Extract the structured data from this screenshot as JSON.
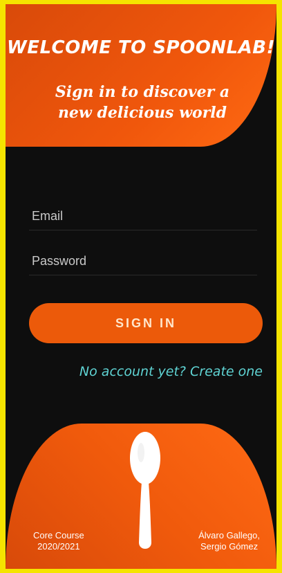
{
  "header": {
    "title": "WELCOME TO SPOONLAB!",
    "subtitle": "Sign in to discover a new delicious world"
  },
  "form": {
    "email_placeholder": "Email",
    "password_placeholder": "Password",
    "signin_label": "SIGN IN",
    "create_account_link": "No account yet? Create one"
  },
  "footer": {
    "left_line1": "Core Course",
    "left_line2": "2020/2021",
    "right_line1": "Álvaro Gallego,",
    "right_line2": "Sergio Gómez",
    "logo_icon": "spoon-icon"
  },
  "colors": {
    "accent": "#ec5a0a",
    "link": "#5fd3d3",
    "background": "#0e0e0e",
    "frame": "#f5e400"
  }
}
